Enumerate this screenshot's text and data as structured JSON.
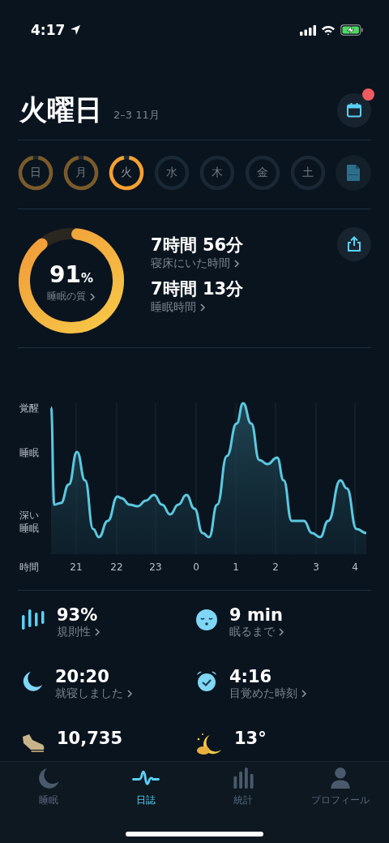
{
  "status_bar": {
    "time": "4:17"
  },
  "header": {
    "title": "火曜日",
    "date_range": "2–3 11月",
    "notification": true
  },
  "days": [
    {
      "label": "日",
      "recorded": true,
      "selected": false
    },
    {
      "label": "月",
      "recorded": true,
      "selected": false
    },
    {
      "label": "火",
      "recorded": true,
      "selected": true
    },
    {
      "label": "水",
      "recorded": false,
      "selected": false
    },
    {
      "label": "木",
      "recorded": false,
      "selected": false
    },
    {
      "label": "金",
      "recorded": false,
      "selected": false
    },
    {
      "label": "土",
      "recorded": false,
      "selected": false
    }
  ],
  "quality": {
    "value": "91",
    "unit": "%",
    "label": "睡眠の質"
  },
  "durations": [
    {
      "value": "7時間 56分",
      "label": "寝床にいた時間"
    },
    {
      "value": "7時間 13分",
      "label": "睡眠時間"
    }
  ],
  "hypnogram": {
    "y_labels": [
      "覚醒",
      "睡眠",
      "深い",
      "睡眠"
    ],
    "x_title": "時間",
    "x_labels": [
      "21",
      "22",
      "23",
      "0",
      "1",
      "2",
      "3",
      "4"
    ]
  },
  "stats": [
    {
      "kind": "regularity",
      "value": "93%",
      "label": "規則性"
    },
    {
      "kind": "asleep",
      "value": "9 min",
      "label": "眠るまで"
    },
    {
      "kind": "bedtime",
      "value": "20:20",
      "label": "就寝しました"
    },
    {
      "kind": "alarm",
      "value": "4:16",
      "label": "目覚めた時刻"
    },
    {
      "kind": "steps",
      "value": "10,735"
    },
    {
      "kind": "weather",
      "value": "13°"
    }
  ],
  "tab_bar": [
    {
      "kind": "sleep",
      "label": "睡眠",
      "selected": false
    },
    {
      "kind": "journal",
      "label": "日誌",
      "selected": true
    },
    {
      "kind": "stats",
      "label": "統計",
      "selected": false
    },
    {
      "kind": "profile",
      "label": "プロフィール",
      "selected": false
    }
  ]
}
